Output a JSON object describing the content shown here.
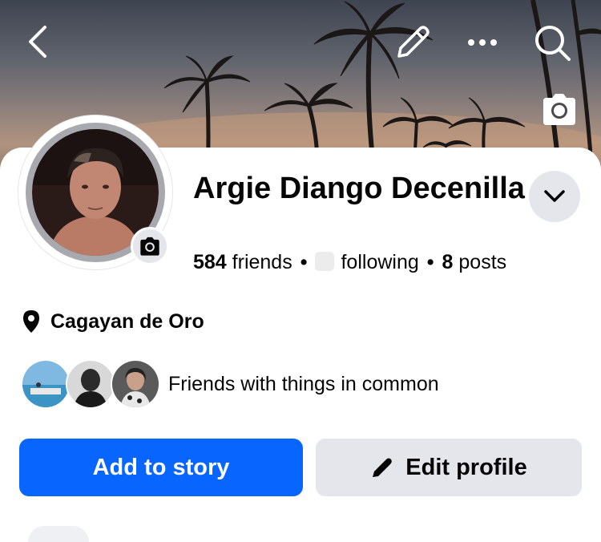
{
  "header": {
    "back_icon": "chevron-left-icon",
    "edit_icon": "pencil-icon",
    "more_icon": "ellipsis-icon",
    "search_icon": "search-icon",
    "cover_camera_icon": "camera-icon"
  },
  "profile": {
    "name": "Argie Diango Decenilla",
    "friends_count": "584",
    "friends_label": "friends",
    "following_label": "following",
    "posts_count": "8",
    "posts_label": "posts",
    "location": "Cagayan de Oro",
    "mutual_text": "Friends with things in common"
  },
  "actions": {
    "add_story_label": "Add to story",
    "edit_profile_label": "Edit profile"
  },
  "colors": {
    "primary": "#0866ff",
    "secondary_button": "#e4e6eb",
    "text": "#050505"
  }
}
